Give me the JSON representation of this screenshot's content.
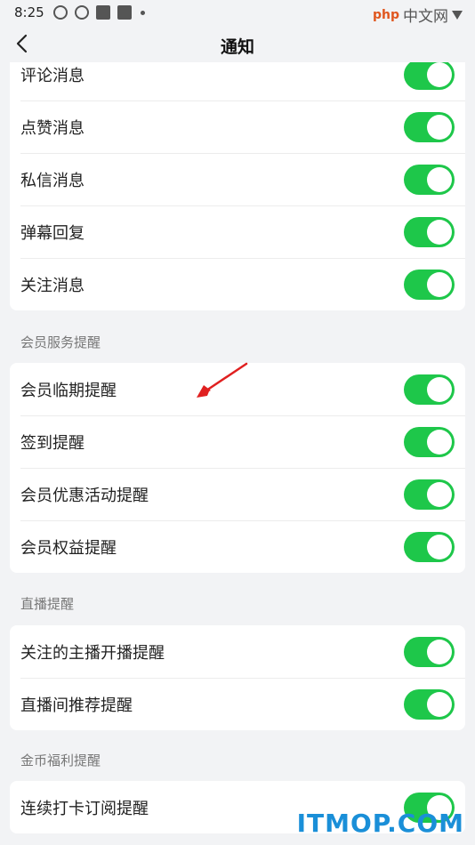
{
  "status_bar": {
    "time": "8:25",
    "watermark_brand": "php",
    "watermark_cn": "中文网"
  },
  "nav": {
    "title": "通知"
  },
  "sections": [
    {
      "header": "",
      "items": [
        {
          "label": "评论消息",
          "on": true
        },
        {
          "label": "点赞消息",
          "on": true
        },
        {
          "label": "私信消息",
          "on": true
        },
        {
          "label": "弹幕回复",
          "on": true
        },
        {
          "label": "关注消息",
          "on": true
        }
      ]
    },
    {
      "header": "会员服务提醒",
      "items": [
        {
          "label": "会员临期提醒",
          "on": true
        },
        {
          "label": "签到提醒",
          "on": true
        },
        {
          "label": "会员优惠活动提醒",
          "on": true
        },
        {
          "label": "会员权益提醒",
          "on": true
        }
      ]
    },
    {
      "header": "直播提醒",
      "items": [
        {
          "label": "关注的主播开播提醒",
          "on": true
        },
        {
          "label": "直播间推荐提醒",
          "on": true
        }
      ]
    },
    {
      "header": "金币福利提醒",
      "items": [
        {
          "label": "连续打卡订阅提醒",
          "on": true
        }
      ]
    }
  ],
  "watermark": {
    "text": "ITMOP.COM"
  },
  "colors": {
    "toggle_on": "#1ec74a",
    "background": "#f2f3f5",
    "arrow": "#e02020"
  }
}
